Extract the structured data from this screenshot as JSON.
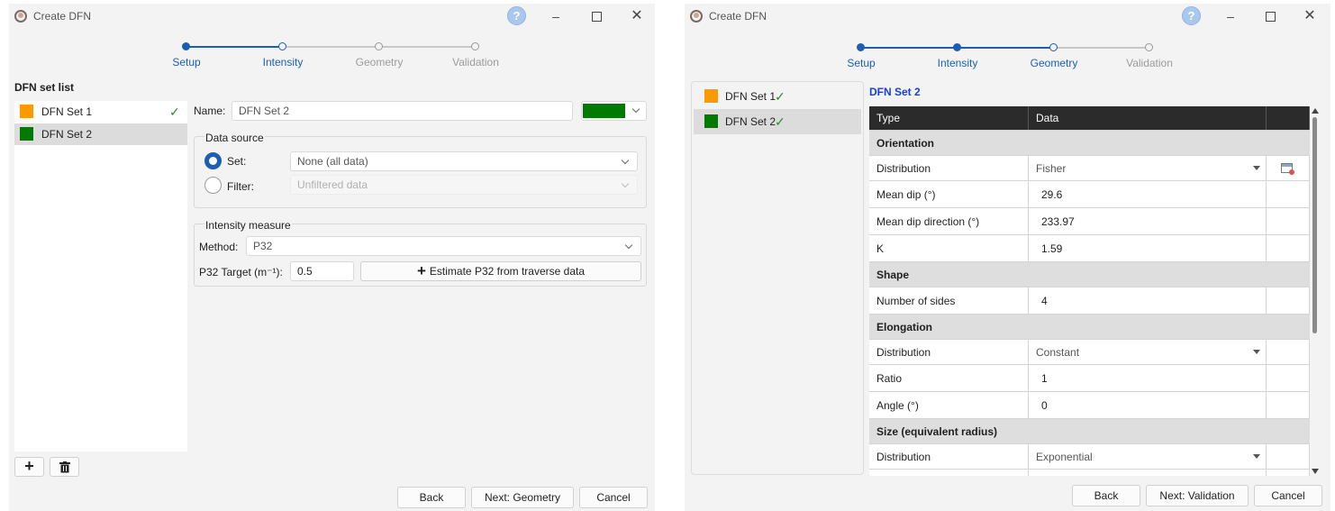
{
  "window1": {
    "title": "Create DFN",
    "help": "?",
    "steps": [
      "Setup",
      "Intensity",
      "Geometry",
      "Validation"
    ],
    "set_list_title": "DFN set list",
    "sets": [
      {
        "name": "DFN Set 1",
        "color": "#ff9900",
        "check": "✓"
      },
      {
        "name": "DFN Set 2",
        "color": "#007a00",
        "check": ""
      }
    ],
    "name_label": "Name:",
    "name_value": "DFN Set 2",
    "name_color": "#007a00",
    "data_source": {
      "title": "Data source",
      "set_label": "Set:",
      "set_value": "None (all data)",
      "filter_label": "Filter:",
      "filter_value": "Unfiltered data"
    },
    "intensity": {
      "title": "Intensity measure",
      "method_label": "Method:",
      "method_value": "P32",
      "target_label": "P32 Target (m⁻¹):",
      "target_value": "0.5",
      "estimate_button": "Estimate P32 from traverse data"
    },
    "add_icon": "+",
    "buttons": {
      "back": "Back",
      "next": "Next: Geometry",
      "cancel": "Cancel"
    }
  },
  "window2": {
    "title": "Create DFN",
    "help": "?",
    "steps": [
      "Setup",
      "Intensity",
      "Geometry",
      "Validation"
    ],
    "sets": [
      {
        "name": "DFN Set 1",
        "color": "#ff9900",
        "check": "✓"
      },
      {
        "name": "DFN Set 2",
        "color": "#007a00",
        "check": "✓"
      }
    ],
    "table_title": "DFN Set 2",
    "table": {
      "headers": [
        "Type",
        "Data"
      ],
      "rows": [
        {
          "kind": "section",
          "label": "Orientation"
        },
        {
          "kind": "dropdown",
          "label": "Distribution",
          "value": "Fisher",
          "extra_icon": "stats-icon"
        },
        {
          "kind": "value",
          "label": "Mean dip (°)",
          "value": "29.6"
        },
        {
          "kind": "value",
          "label": "Mean dip direction (°)",
          "value": "233.97"
        },
        {
          "kind": "value",
          "label": "K",
          "value": "1.59"
        },
        {
          "kind": "section",
          "label": "Shape"
        },
        {
          "kind": "value",
          "label": "Number of sides",
          "value": "4"
        },
        {
          "kind": "section",
          "label": "Elongation"
        },
        {
          "kind": "dropdown",
          "label": "Distribution",
          "value": "Constant"
        },
        {
          "kind": "value",
          "label": "Ratio",
          "value": "1"
        },
        {
          "kind": "value",
          "label": "Angle (°)",
          "value": "0"
        },
        {
          "kind": "section",
          "label": "Size (equivalent radius)"
        },
        {
          "kind": "dropdown",
          "label": "Distribution",
          "value": "Exponential"
        },
        {
          "kind": "value",
          "label": "",
          "value": ""
        }
      ]
    },
    "buttons": {
      "back": "Back",
      "next": "Next: Validation",
      "cancel": "Cancel"
    }
  }
}
